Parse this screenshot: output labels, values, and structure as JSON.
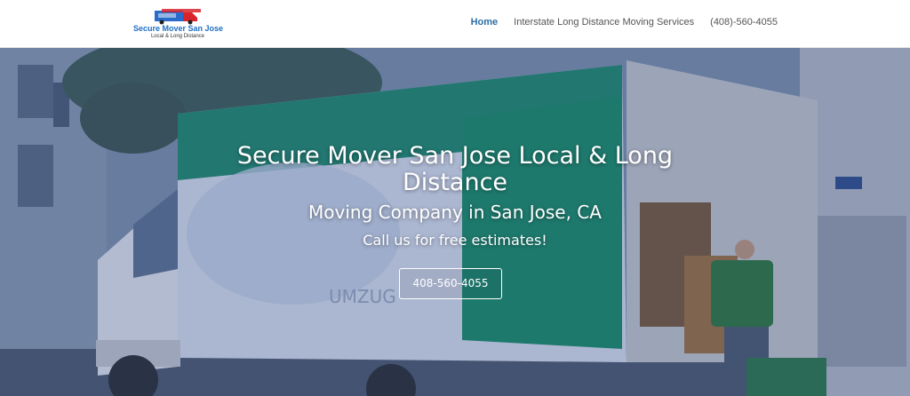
{
  "brand": {
    "name": "Secure Mover San Jose",
    "tagline": "Local & Long Distance",
    "logo_icon": "moving-truck-icon"
  },
  "nav": {
    "items": [
      {
        "label": "Home",
        "active": true
      },
      {
        "label": "Interstate Long Distance Moving Services",
        "active": false
      },
      {
        "label": "(408)-560-4055",
        "active": false
      }
    ]
  },
  "hero": {
    "title": "Secure Mover San Jose Local & Long Distance",
    "subtitle": "Moving Company in San Jose, CA",
    "cta_text": "Call us for free estimates!",
    "button_label": "408-560-4055",
    "truck_lettering": "UMZUG"
  },
  "colors": {
    "nav_active": "#2e6ea6",
    "hero_overlay": "#2b3f7a",
    "truck_green": "#1a8f68"
  }
}
